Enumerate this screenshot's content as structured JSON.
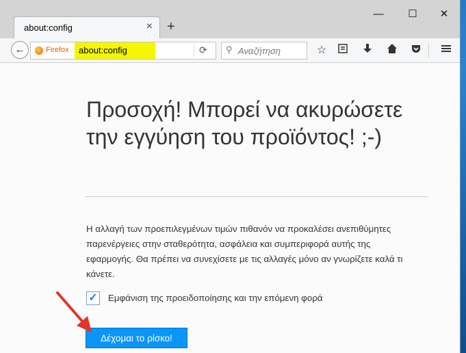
{
  "tab": {
    "title": "about:config",
    "close_symbol": "×"
  },
  "newtab_symbol": "+",
  "window_controls": {
    "minimize": "—",
    "maximize": "☐",
    "close": "✕"
  },
  "navbar": {
    "identity_label": "Firefox",
    "url": "about:config",
    "search_placeholder": "Αναζήτηση"
  },
  "page": {
    "heading": "Προσοχή! Μπορεί να ακυρώσετε την εγγύηση του προϊόντος! ;-)",
    "warning_text": "Η αλλαγή των προεπιλεγμένων τιμών πιθανόν να προκαλέσει ανεπιθύμητες παρενέργειες στην σταθερότητα, ασφάλεια και συμπεριφορά αυτής της εφαρμογής. Θα πρέπει να συνεχίσετε με τις αλλαγές μόνο αν γνωρίζετε καλά τι κάνετε.",
    "checkbox_label": "Εμφάνιση της προειδοποίησης και την επόμενη φορά",
    "checkbox_checked": true,
    "accept_button": "Δέχομαι το ρίσκο!"
  },
  "colors": {
    "url_highlight": "#f4f700",
    "accent": "#0996f8",
    "annotation_arrow": "#e0352b"
  }
}
